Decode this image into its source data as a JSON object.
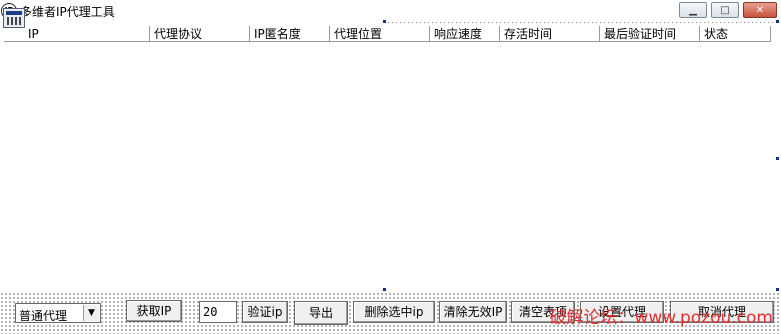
{
  "window": {
    "title": "多维者IP代理工具",
    "app_icon_text": "IP",
    "minimize_glyph": "▁",
    "maximize_glyph": "□",
    "close_glyph": "✕"
  },
  "table": {
    "columns": [
      "IP",
      "代理协议",
      "IP匿名度",
      "代理位置",
      "响应速度",
      "存活时间",
      "最后验证时间",
      "状态"
    ],
    "rows": []
  },
  "controls": {
    "proxy_type": {
      "selected": "普通代理"
    },
    "get_ip_label": "获取IP",
    "count_value": "20",
    "verify_label": "验证ip",
    "export_label": "导出",
    "delete_selected_label": "删除选中ip",
    "clear_invalid_label": "清除无效IP",
    "clear_list_label": "清空表项",
    "set_proxy_label": "设置代理",
    "cancel_proxy_label": "取消代理"
  },
  "watermark": "破解论坛：www.pozou.com"
}
